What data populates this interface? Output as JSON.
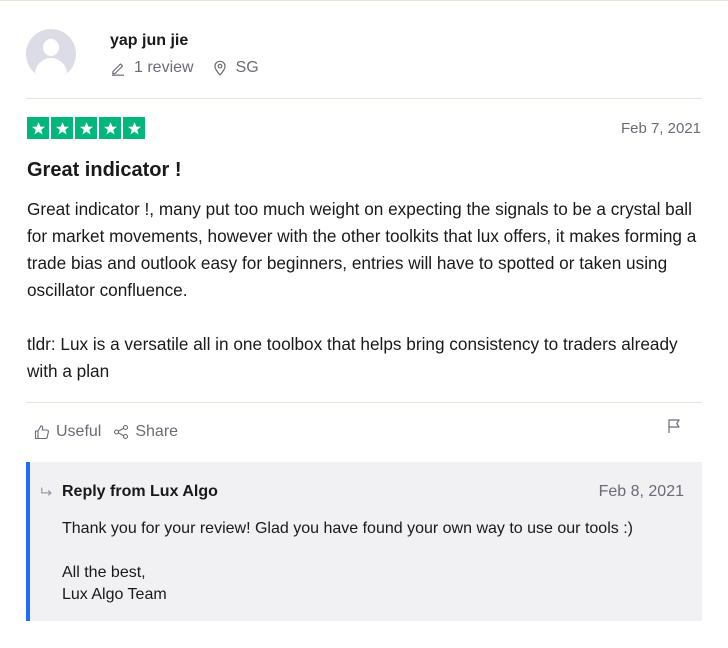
{
  "reviewer": {
    "name": "yap jun jie",
    "review_count": "1 review",
    "location": "SG"
  },
  "review": {
    "rating": 5,
    "date": "Feb 7, 2021",
    "title": "Great indicator !",
    "paragraph1": "Great indicator !, many put too much weight on expecting the signals to be a crystal ball for market movements, however with the other toolkits that lux offers, it makes forming a trade bias and outlook easy for beginners, entries will have to spotted or taken using oscillator confluence.",
    "paragraph2": "tldr: Lux is a versatile all in one toolbox that helps bring consistency to traders already with a plan"
  },
  "actions": {
    "useful_label": "Useful",
    "share_label": "Share"
  },
  "reply": {
    "title": "Reply from Lux Algo",
    "date": "Feb 8, 2021",
    "paragraph1": "Thank you for your review! Glad you have found your own way to use our tools :)",
    "line1": "All the best,",
    "line2": "Lux Algo Team"
  },
  "colors": {
    "star_green": "#00b67a",
    "reply_accent": "#1c6cfd",
    "reply_background": "#f1f1f4"
  }
}
